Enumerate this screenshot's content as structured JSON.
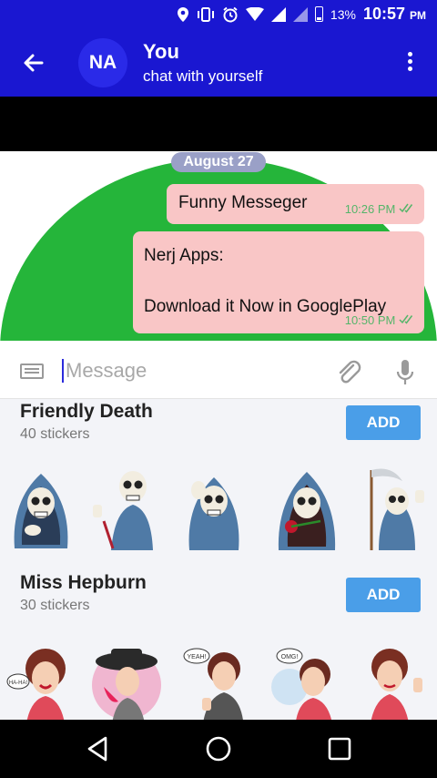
{
  "status_bar": {
    "battery_percent": "13%",
    "time": "10:57",
    "time_suffix": "PM"
  },
  "header": {
    "back_icon": "arrow-left-icon",
    "avatar_initials": "NA",
    "title": "You",
    "subtitle": "chat with yourself",
    "menu_icon": "more-vertical-icon"
  },
  "chat": {
    "date_chip": "August 27",
    "messages": [
      {
        "text": "Funny Messeger",
        "time": "10:26 PM"
      },
      {
        "line1": "Nerj Apps:",
        "line2": "Download it Now in GooglePlay",
        "time": "10:50 PM"
      }
    ]
  },
  "composer": {
    "placeholder": "Message",
    "value": ""
  },
  "sticker_packs": [
    {
      "name": "Friendly Death",
      "count": "40 stickers",
      "add_label": "ADD"
    },
    {
      "name": "Miss Hepburn",
      "count": "30 stickers",
      "add_label": "ADD"
    }
  ],
  "sticker_bubbles": {
    "haha": "HA-HA!",
    "yeah": "YEAH!",
    "omg": "OMG!"
  },
  "colors": {
    "app_bar": "#1a17d1",
    "bubble": "#f9c6c6",
    "add_button": "#4a9ee8",
    "chat_background_circle": "#25b53a"
  }
}
